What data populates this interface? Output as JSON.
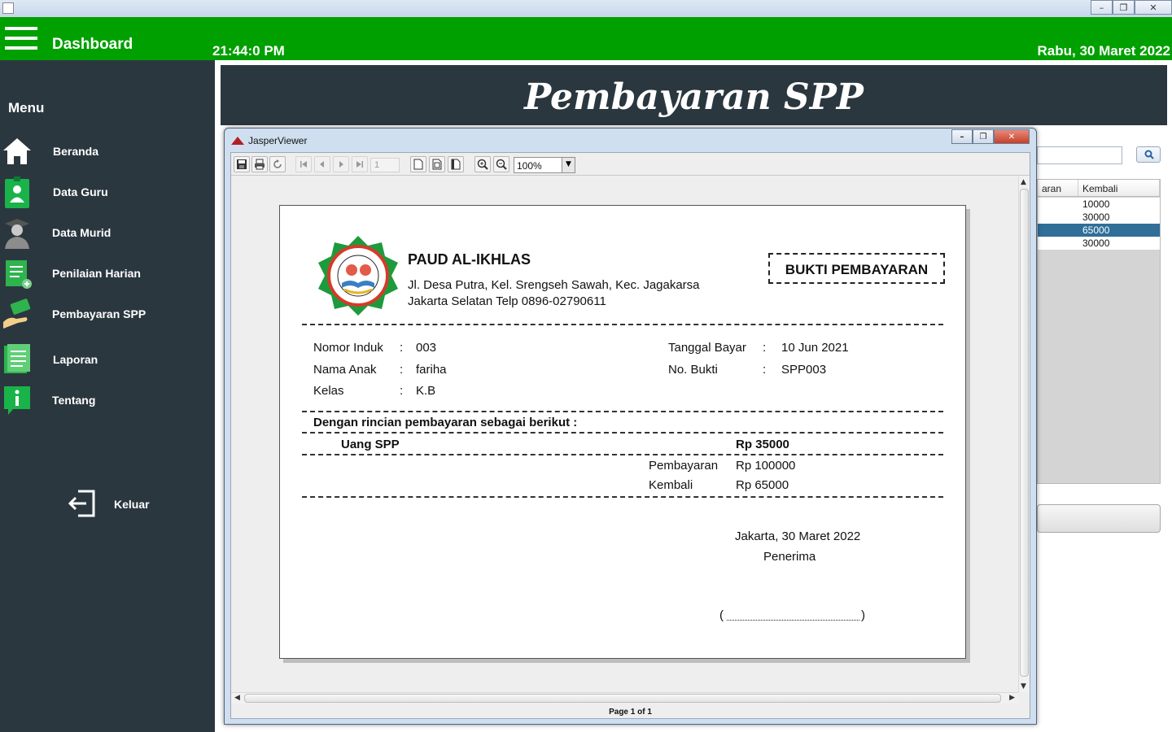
{
  "header": {
    "title": "Dashboard",
    "clock": "21:44:0 PM",
    "date": "Rabu, 30 Maret 2022"
  },
  "sidebar": {
    "heading": "Menu",
    "items": [
      {
        "label": "Beranda",
        "icon": "home-icon"
      },
      {
        "label": "Data Guru",
        "icon": "teacher-icon"
      },
      {
        "label": "Data Murid",
        "icon": "student-icon"
      },
      {
        "label": "Penilaian Harian",
        "icon": "grading-icon"
      },
      {
        "label": "Pembayaran SPP",
        "icon": "payment-icon"
      },
      {
        "label": "Laporan",
        "icon": "report-icon"
      },
      {
        "label": "Tentang",
        "icon": "info-icon"
      }
    ],
    "logout": "Keluar"
  },
  "main": {
    "banner_title": "Pembayaran SPP",
    "background_table": {
      "columns": [
        "aran",
        "Kembali"
      ],
      "rows": [
        "10000",
        "30000",
        "65000",
        "30000"
      ],
      "selected_index": 2
    }
  },
  "viewer": {
    "title": "JasperViewer",
    "page_field": "1",
    "zoom": "100%",
    "status": "Page 1 of 1"
  },
  "report": {
    "school": "PAUD AL-IKHLAS",
    "address_line1": "Jl. Desa Putra, Kel. Srengseh Sawah, Kec. Jagakarsa",
    "address_line2": "Jakarta Selatan  Telp 0896-02790611",
    "doc_title": "BUKTI PEMBAYARAN",
    "fields": {
      "nomor_induk_label": "Nomor Induk",
      "nomor_induk": "003",
      "nama_anak_label": "Nama Anak",
      "nama_anak": "fariha",
      "kelas_label": "Kelas",
      "kelas": "K.B",
      "tanggal_bayar_label": "Tanggal Bayar",
      "tanggal_bayar": "10 Jun 2021",
      "no_bukti_label": "No. Bukti",
      "no_bukti": "SPP003",
      "colon": ":"
    },
    "detail_heading": "Dengan rincian pembayaran sebagai berikut :",
    "item_label": "Uang SPP",
    "item_amount": "Rp 35000",
    "pembayaran_label": "Pembayaran",
    "pembayaran_amount": "Rp  100000",
    "kembali_label": "Kembali",
    "kembali_amount": "Rp  65000",
    "place_date": "Jakarta, 30 Maret 2022",
    "receiver": "Penerima",
    "sig_open": "(",
    "sig_close": ")"
  },
  "colors": {
    "header_green": "#00a000",
    "sidebar_dark": "#2b373f",
    "selection_blue": "#2f6f98"
  }
}
